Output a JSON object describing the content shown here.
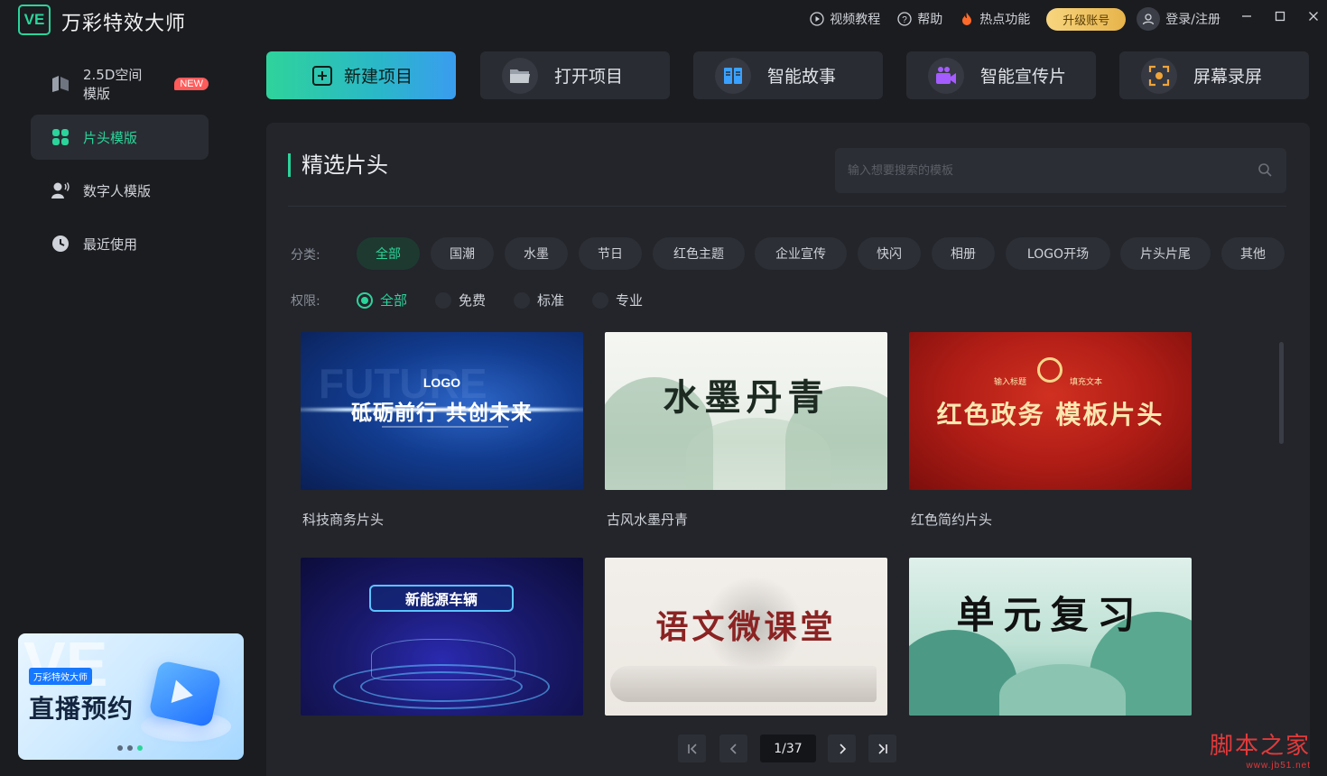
{
  "app": {
    "logo_text": "VE",
    "title": "万彩特效大师"
  },
  "top_links": {
    "tutorial": "视频教程",
    "help": "帮助",
    "hot": "热点功能",
    "upgrade": "升级账号",
    "login": "登录/注册"
  },
  "sidebar": {
    "items": [
      {
        "label": "2.5D空间模版",
        "icon": "cube-icon",
        "badge": "NEW"
      },
      {
        "label": "片头模版",
        "icon": "grid-icon"
      },
      {
        "label": "数字人模版",
        "icon": "digital-human-icon"
      },
      {
        "label": "最近使用",
        "icon": "clock-icon"
      }
    ],
    "promo": {
      "tag": "万彩特效大师",
      "title": "直播预约",
      "bg_text": "VE"
    }
  },
  "actions": [
    {
      "label": "新建项目",
      "icon": "plus-square-icon"
    },
    {
      "label": "打开项目",
      "icon": "folder-icon"
    },
    {
      "label": "智能故事",
      "icon": "book-icon"
    },
    {
      "label": "智能宣传片",
      "icon": "video-camera-icon"
    },
    {
      "label": "屏幕录屏",
      "icon": "screen-record-icon"
    }
  ],
  "main": {
    "section_title": "精选片头",
    "search_placeholder": "输入想要搜索的模板",
    "category_label": "分类:",
    "categories": [
      "全部",
      "国潮",
      "水墨",
      "节日",
      "红色主题",
      "企业宣传",
      "快闪",
      "相册",
      "LOGO开场",
      "片头片尾",
      "其他"
    ],
    "permission_label": "权限:",
    "permissions": [
      "全部",
      "免费",
      "标准",
      "专业"
    ]
  },
  "cards": [
    {
      "label": "科技商务片头",
      "thumb_logo": "LOGO",
      "thumb_text": "砥砺前行 共创未来"
    },
    {
      "label": "古风水墨丹青",
      "thumb_text": "水墨丹青"
    },
    {
      "label": "红色简约片头",
      "thumb_text": "红色政务 模板片头",
      "thumb_small_left": "输入标题",
      "thumb_small_right": "填充文本"
    },
    {
      "label": "",
      "thumb_text": "新能源车辆"
    },
    {
      "label": "",
      "thumb_text": "语文微课堂"
    },
    {
      "label": "",
      "thumb_text": "单元复习"
    }
  ],
  "pagination": {
    "current": "1/37"
  },
  "watermark": {
    "line1": "脚本之家",
    "line2": "www.jb51.net"
  },
  "colors": {
    "accent": "#2bd49a",
    "background": "#1b1c20",
    "panel": "#23252b",
    "upgrade": "#f0c35e"
  }
}
